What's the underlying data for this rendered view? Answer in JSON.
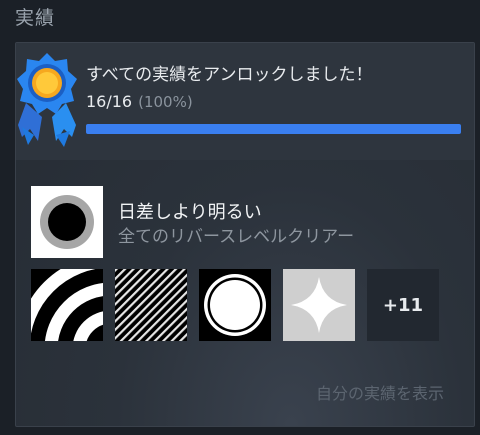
{
  "section": {
    "title": "実績"
  },
  "summary": {
    "title": "すべての実績をアンロックしました！",
    "count_text": "16/16",
    "percent_text": "(100%)",
    "progress_fraction": 1.0,
    "accent_color": "#3a7ff0"
  },
  "featured": {
    "name": "日差しより明るい",
    "description": "全てのリバースレベルクリアー",
    "icon": "black-circle-ring-icon"
  },
  "achievements": [
    {
      "icon": "curved-stripes-icon"
    },
    {
      "icon": "diagonal-lines-icon"
    },
    {
      "icon": "white-circle-icon"
    },
    {
      "icon": "four-point-star-icon"
    }
  ],
  "more": {
    "label": "+11"
  },
  "link": {
    "label": "自分の実績を表示"
  }
}
